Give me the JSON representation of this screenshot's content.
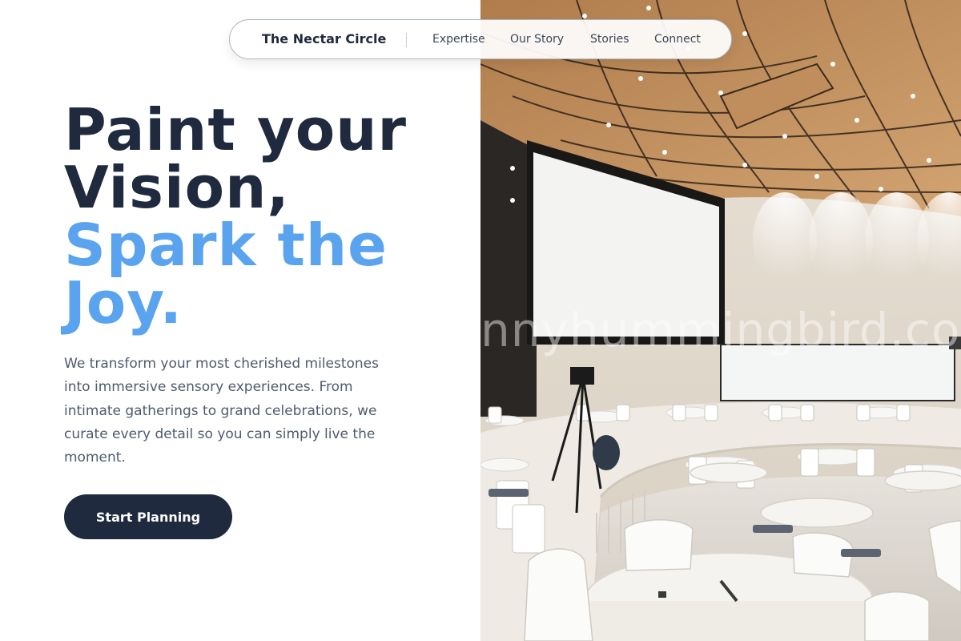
{
  "nav": {
    "brand": "The Nectar Circle",
    "links": [
      "Expertise",
      "Our Story",
      "Stories",
      "Connect"
    ]
  },
  "hero": {
    "headline_lines": [
      "Paint your",
      "Vision,"
    ],
    "headline_accent_lines": [
      "Spark the",
      "Joy."
    ],
    "subtitle": "We transform your most cherished milestones into immersive sensory experiences. From intimate gatherings to grand celebrations, we curate every detail so you can simply live the moment.",
    "cta_label": "Start Planning"
  },
  "photo": {
    "watermark": "nnyhummingbird.co"
  },
  "colors": {
    "navy": "#1f2a3e",
    "accent": "#5aa3ef",
    "body_text": "#4d5b6e"
  }
}
